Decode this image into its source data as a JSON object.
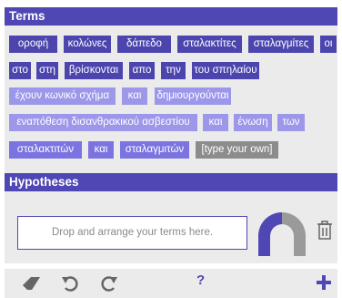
{
  "terms": {
    "title": "Terms",
    "tiles": [
      {
        "label": "οροφή",
        "tone": "dark"
      },
      {
        "label": "κολώνες",
        "tone": "dark"
      },
      {
        "label": "δάπεδο",
        "tone": "dark"
      },
      {
        "label": "σταλακτίτες",
        "tone": "dark"
      },
      {
        "label": "σταλαγμίτες",
        "tone": "dark"
      },
      {
        "label": "οι",
        "tone": "dark"
      },
      {
        "label": "στο",
        "tone": "dark"
      },
      {
        "label": "στη",
        "tone": "dark"
      },
      {
        "label": "βρίσκονται",
        "tone": "dark"
      },
      {
        "label": "απο",
        "tone": "dark"
      },
      {
        "label": "την",
        "tone": "dark"
      },
      {
        "label": "του σπηλαίου",
        "tone": "dark"
      },
      {
        "label": "έχουν κωνικό σχήμα",
        "tone": "light"
      },
      {
        "label": "και",
        "tone": "light"
      },
      {
        "label": "δημιουργούνται",
        "tone": "light"
      },
      {
        "label": "εναπόθεση δισανθρακικού ασβεστίου",
        "tone": "light"
      },
      {
        "label": "και",
        "tone": "light"
      },
      {
        "label": "ένωση",
        "tone": "light"
      },
      {
        "label": "των",
        "tone": "light"
      },
      {
        "label": "σταλακτιτών",
        "tone": "medium"
      },
      {
        "label": "και",
        "tone": "medium"
      },
      {
        "label": "σταλαγμιτών",
        "tone": "medium"
      },
      {
        "label": "[type your own]",
        "tone": "grey"
      }
    ]
  },
  "hypotheses": {
    "title": "Hypotheses",
    "drop_placeholder": "Drop and arrange your terms here.",
    "progress_fraction": 0.5
  },
  "toolbar": {
    "help_label": "?"
  },
  "icons": [
    "eraser-icon",
    "undo-icon",
    "redo-icon",
    "help-icon",
    "add-icon",
    "trash-icon"
  ],
  "colors": {
    "accent": "#4f47b4",
    "tile_dark": "#4c45ae",
    "tile_medium": "#7b73e0",
    "tile_light": "#9d97ea",
    "tile_grey": "#8c8c8c"
  }
}
